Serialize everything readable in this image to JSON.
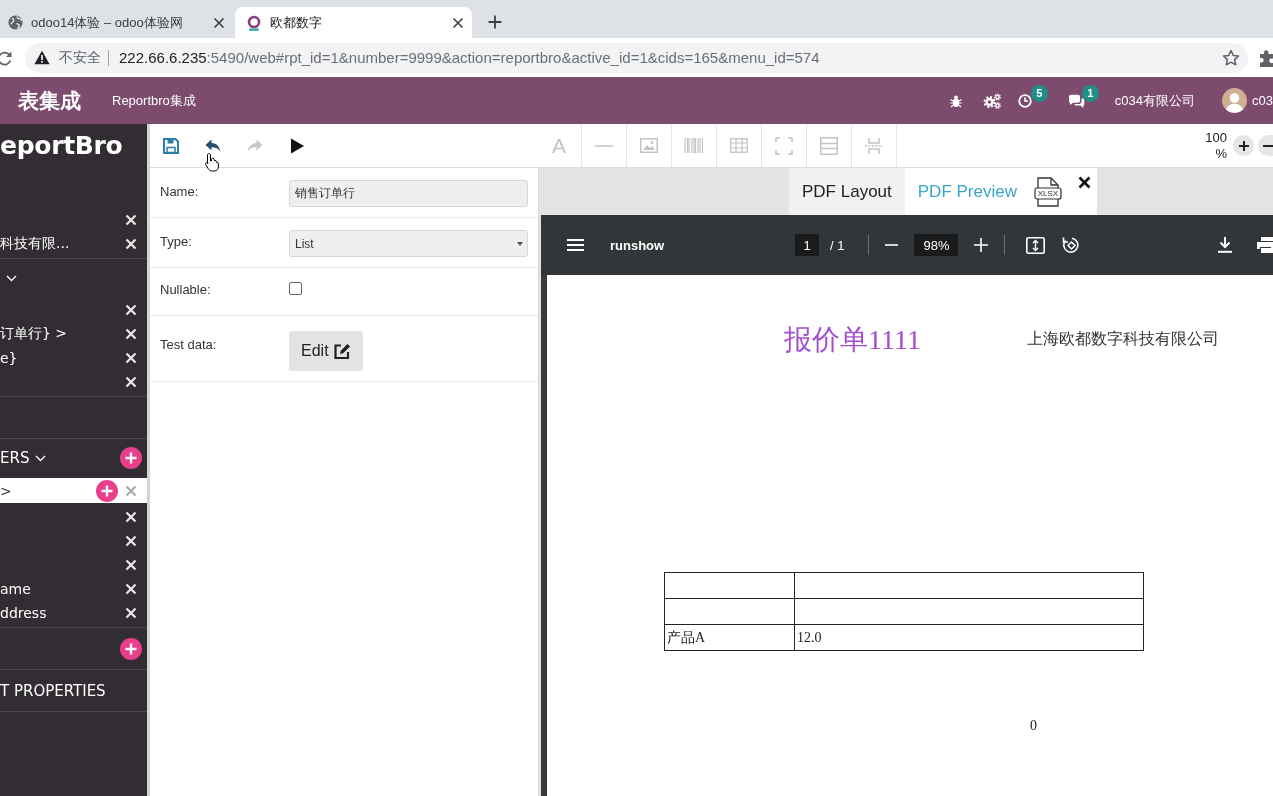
{
  "browser": {
    "tabs": [
      {
        "title": "odoo14体验 – odoo体验网",
        "selected": false
      },
      {
        "title": "欧都数字",
        "selected": true
      }
    ],
    "address": {
      "security": "不安全",
      "host": "222.66.6.235",
      "path": ":5490/web#rpt_id=1&number=9999&action=reportbro&active_id=1&cids=165&menu_id=574"
    }
  },
  "header": {
    "app": "表集成",
    "menu": [
      "Reportbro集成"
    ],
    "activity_count": "5",
    "message_count": "1",
    "company": "c034有限公司",
    "user": "c03"
  },
  "sidebar": {
    "logo": "eportBro",
    "sections": [
      {
        "kind": "list",
        "rows": [
          {
            "selected": false
          },
          {
            "label": "科技有限...",
            "selected": false
          }
        ]
      },
      {
        "kind": "list",
        "header": {
          "expanded": true
        },
        "rows": [
          {
            "selected": false
          },
          {
            "label": "订单行} >",
            "selected": false
          },
          {
            "label": "e}",
            "selected": false
          },
          {
            "selected": false
          }
        ]
      },
      {
        "kind": "header"
      },
      {
        "kind": "list",
        "header": {
          "label": "ERS",
          "expanded": true,
          "add": true
        },
        "rows": [
          {
            "label": ">",
            "selected": true,
            "add": true
          },
          {
            "selected": false
          },
          {
            "selected": false
          },
          {
            "selected": false
          },
          {
            "label": "ame",
            "selected": false
          },
          {
            "label": "ddress",
            "selected": false
          }
        ]
      },
      {
        "kind": "header",
        "add": true
      },
      {
        "kind": "header",
        "label": "T PROPERTIES"
      }
    ]
  },
  "toolbar": {
    "actions": [
      {
        "kind": "save",
        "disabled": false
      },
      {
        "kind": "undo",
        "disabled": false
      },
      {
        "kind": "redo",
        "disabled": true
      },
      {
        "kind": "preview",
        "disabled": false
      }
    ],
    "tools": [
      {
        "kind": "text",
        "label": "A",
        "disabled": true
      },
      {
        "kind": "line",
        "disabled": true
      },
      {
        "kind": "image",
        "disabled": true
      },
      {
        "kind": "barcode",
        "disabled": true
      },
      {
        "kind": "table",
        "disabled": true
      },
      {
        "kind": "frame",
        "disabled": true
      },
      {
        "kind": "section",
        "disabled": true
      },
      {
        "kind": "page_break",
        "disabled": true
      }
    ],
    "zoom": "100 %"
  },
  "properties": [
    {
      "kind": "text",
      "label": "Name:",
      "value": "销售订单行"
    },
    {
      "kind": "select",
      "label": "Type:",
      "value": "List"
    },
    {
      "kind": "checkbox",
      "label": "Nullable:",
      "checked": false
    },
    {
      "kind": "button",
      "label": "Test data:",
      "button": "Edit"
    }
  ],
  "preview": {
    "tabs": [
      {
        "label": "PDF Layout",
        "selected": false
      },
      {
        "label": "PDF Preview",
        "selected": true
      }
    ],
    "export": "XLSX",
    "viewer": {
      "title": "runshow",
      "page": "1",
      "page_total": "/ 1",
      "zoom": "98%"
    },
    "document": {
      "title": "报价单1111",
      "company": "上海欧都数字科技有限公司",
      "table": {
        "rows": [
          {
            "kind": "empty"
          },
          {
            "kind": "empty"
          },
          {
            "kind": "data",
            "cells": [
              "产品A",
              "12.0"
            ]
          }
        ]
      },
      "footer": "0"
    }
  }
}
